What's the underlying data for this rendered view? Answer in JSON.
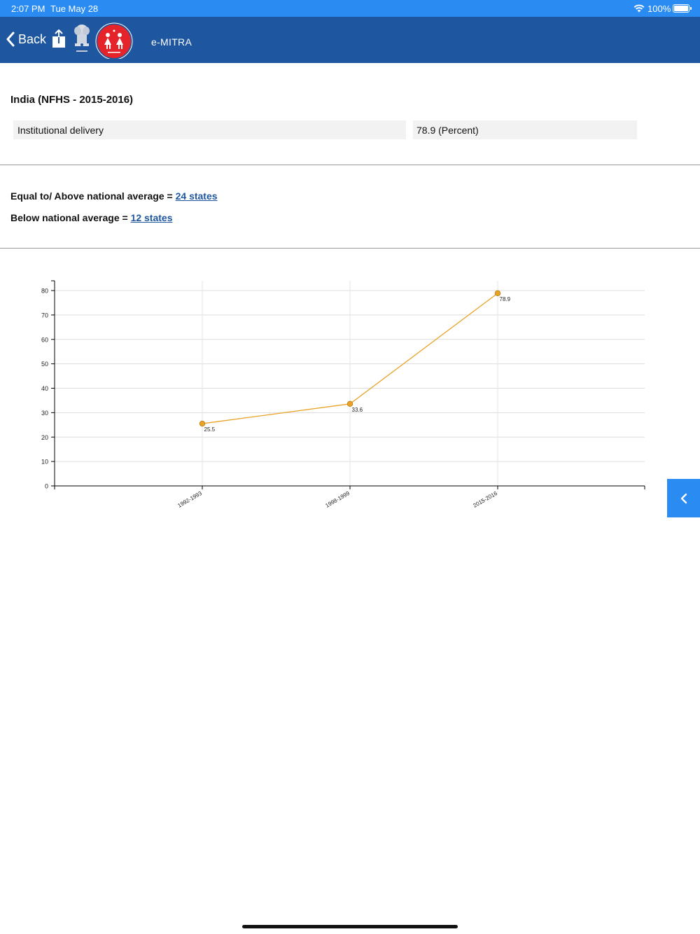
{
  "status_bar": {
    "time": "2:07 PM",
    "date": "Tue May 28",
    "battery": "100%"
  },
  "nav": {
    "back_label": "Back",
    "title": "e-MITRA",
    "logo_text": "NATIONAL HEALTH MISSION",
    "icons": [
      "chevron-left-icon",
      "share-icon",
      "state-emblem-logo",
      "nhm-logo"
    ]
  },
  "summary": {
    "region_title": "India (NFHS - 2015-2016)",
    "indicator": "Institutional delivery",
    "value": "78.9 (Percent)"
  },
  "averages": {
    "above_label": "Equal to/ Above national average = ",
    "above_link": "24 states",
    "below_label": "Below national average = ",
    "below_link": "12 states"
  },
  "chart_data": {
    "type": "line",
    "categories": [
      "1992-1993",
      "1998-1999",
      "2015-2016"
    ],
    "values": [
      25.5,
      33.6,
      78.9
    ],
    "data_labels": [
      "25.5",
      "33.6",
      "78.9"
    ],
    "ylim": [
      0,
      80
    ],
    "yticks": [
      0,
      10,
      20,
      30,
      40,
      50,
      60,
      70,
      80
    ],
    "ytick_labels": [
      "0",
      "10",
      "20",
      "30",
      "40",
      "50",
      "60",
      "70",
      "80"
    ],
    "grid": true,
    "color": "#e9a227",
    "title": "",
    "xlabel": "",
    "ylabel": ""
  },
  "side_tab": {
    "icon": "chevron-left-icon"
  }
}
